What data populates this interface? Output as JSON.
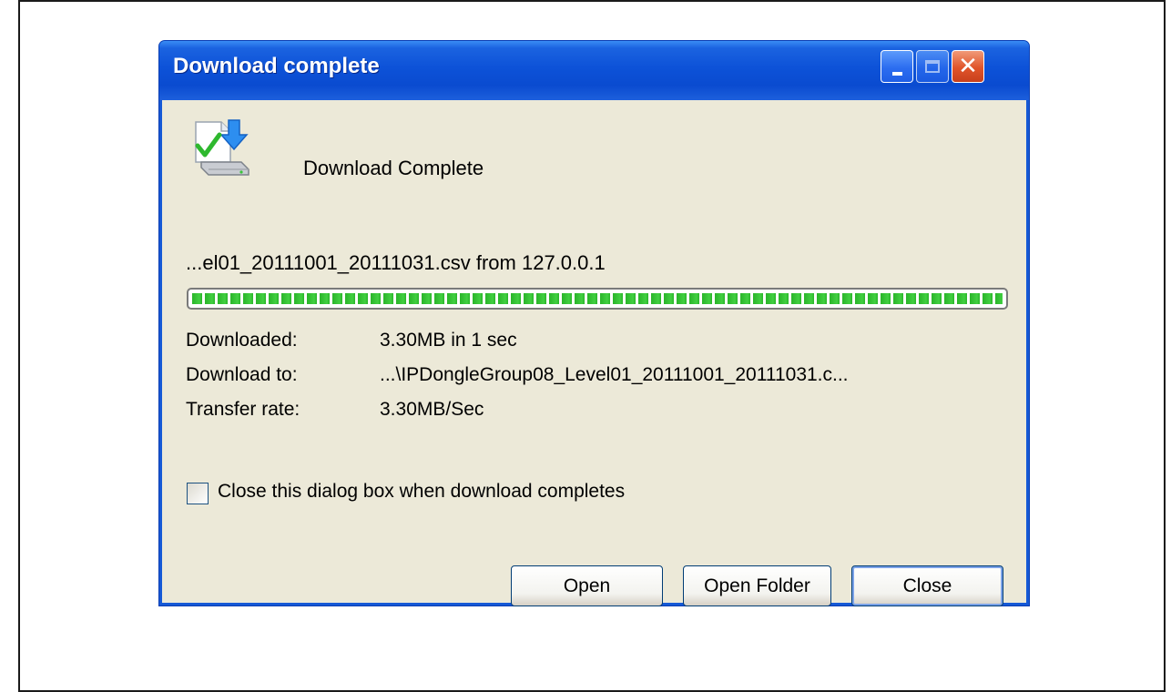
{
  "window": {
    "title": "Download complete",
    "controls": {
      "minimize_icon": "minimize-icon",
      "maximize_icon": "maximize-icon",
      "close_icon": "close-icon"
    }
  },
  "header": {
    "icon": "download-complete-icon",
    "title": "Download Complete"
  },
  "file_line": "...el01_20111001_20111031.csv from 127.0.0.1",
  "progress": {
    "percent": 100
  },
  "details": {
    "downloaded_label": "Downloaded:",
    "downloaded_value": "3.30MB in 1 sec",
    "download_to_label": "Download to:",
    "download_to_value": "...\\IPDongleGroup08_Level01_20111001_20111031.c...",
    "transfer_rate_label": "Transfer rate:",
    "transfer_rate_value": "3.30MB/Sec"
  },
  "close_when_done": {
    "label": "Close this dialog box when download completes",
    "checked": false
  },
  "buttons": {
    "open": "Open",
    "open_folder": "Open Folder",
    "close": "Close"
  },
  "colors": {
    "titlebar": "#0a4bd0",
    "client_bg": "#ece9d8",
    "progress_green": "#2ab42a",
    "close_button_red": "#e0542a"
  }
}
